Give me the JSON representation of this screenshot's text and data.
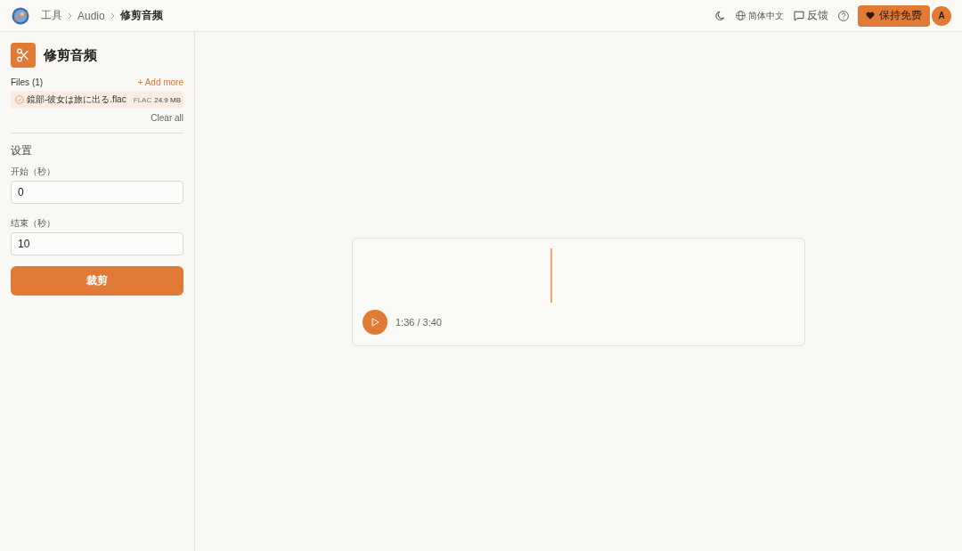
{
  "header": {
    "breadcrumbs": [
      {
        "label": "工具",
        "selected": false
      },
      {
        "label": "Audio",
        "selected": false
      },
      {
        "label": "修剪音频",
        "selected": true
      }
    ],
    "language": "简体中文",
    "feedback": "反馈",
    "support_button": "保持免费",
    "avatar": "A"
  },
  "sidebar": {
    "title": "修剪音频",
    "files_label": "Files (1)",
    "add_more": "+ Add more",
    "files": [
      {
        "name": "鏡部-彼女は旅に出る.flac",
        "format": "FLAC",
        "size": "24.9 MB"
      }
    ],
    "clear_all": "Clear all",
    "settings_title": "设置",
    "fields": [
      {
        "label": "开始（秒）",
        "value": "0"
      },
      {
        "label": "结束（秒）",
        "value": "10"
      }
    ],
    "submit_button": "裁剪"
  },
  "player": {
    "level": 0.436,
    "time": "1:36 / 3:40"
  }
}
